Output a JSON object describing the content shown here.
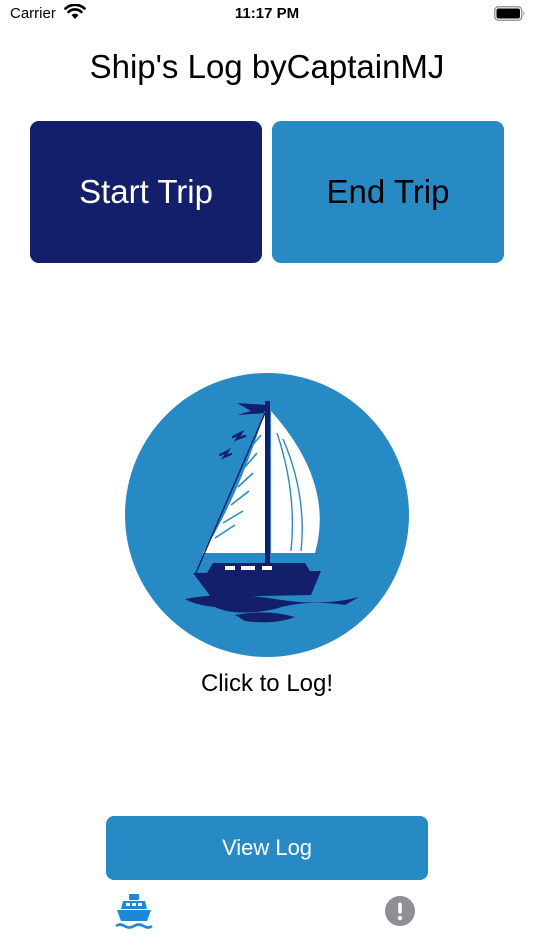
{
  "status_bar": {
    "carrier": "Carrier",
    "time": "11:17 PM"
  },
  "title": "Ship's Log byCaptainMJ",
  "buttons": {
    "start_trip": "Start Trip",
    "end_trip": "End Trip",
    "view_log": "View Log"
  },
  "log_prompt": "Click to Log!",
  "tabs": [
    {
      "icon": "boat-icon",
      "active": true
    },
    {
      "icon": "info-icon",
      "active": false
    }
  ],
  "colors": {
    "navy": "#131f6b",
    "accent_blue": "#288ac5",
    "tab_active": "#1e88d8",
    "tab_inactive": "#8e8e93"
  }
}
